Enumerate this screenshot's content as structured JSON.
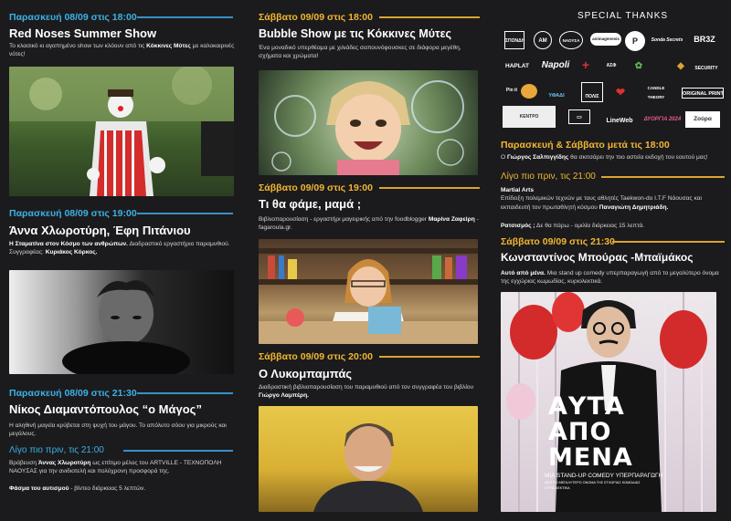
{
  "col1": {
    "e1": {
      "date": "Παρασκευή 08/09 στις 18:00",
      "title": "Red Noses Summer Show",
      "desc_a": "Το κλασικό κι αγαπημένο show των κλόουν από τις ",
      "desc_b": "Κόκκινες Μύτες",
      "desc_c": " με καλοκαιρινές νότες!"
    },
    "e2": {
      "date": "Παρασκευή 08/09 στις 19:00",
      "title": "Άννα Χλωροτύρη, Έφη Πιτάνιου",
      "desc_a": "Η Σταματίνα στον Κόσμο των ανθρώπων.",
      "desc_b": " Διαδραστικό εργαστήριο παραμυθιού.",
      "desc_c": "Συγγραφέας: ",
      "desc_d": "Κυριάκος Κόρκος."
    },
    "e3": {
      "date": "Παρασκευή 08/09 στις 21:30",
      "title": "Νίκος Διαμαντόπουλος “ο Μάγος”",
      "desc": "Η αληθινή μαγεία κρύβεται στη ψυχή του μάγου. Το απόλυτο σόου για μικρούς και μεγάλους."
    },
    "e4": {
      "date": "Λίγο πιο πριν, τις 21:00",
      "desc_a": "Βράβευση ",
      "desc_b": "Άννας Χλωροτύρη",
      "desc_c": " ως επίτιμο μέλος του ARTVILLE - ΤΕΧΝΟΠΟΛΗ ΝΑΟΥΣΑΣ για την ανιδιοτελή και πολύχρονη  προσφορά της.",
      "desc_d": "Φάσμα του αυτισμού",
      "desc_e": " - βίντεο διάρκειας 5 λεπτών."
    }
  },
  "col2": {
    "e1": {
      "date": "Σάββατο 09/09 στις 18:00",
      "title": "Bubble Show με τις Κόκκινες Μύτες",
      "desc": "Ένα μοναδικό υπερθέαμα με χιλιάδες σαπουνόφουσκες σε διάφορα μεγέθη, σχήματα και χρώματα!"
    },
    "e2": {
      "date": "Σάββατο 09/09 στις 19:00",
      "title": "Τι θα φάμε, μαμά ;",
      "desc_a": "Βιβλιοπαρουσίαση - εργαστήρι μαγειρικής από την foodblogger ",
      "desc_b": "Μαρίνα Ζαφείρη",
      "desc_c": " - fagaroula.gr."
    },
    "e3": {
      "date": "Σάββατο 09/09 στις 20:00",
      "title": "Ο Λυκομπαμπάς",
      "desc_a": "Διαδραστική βιβλιοπαρουσίαση του παραμυθιού από τον συγγραφέα του βιβλίου ",
      "desc_b": "Γιώργο Λαμπέρη."
    }
  },
  "col3": {
    "thanks": "SPECIAL THANKS",
    "logos": [
      "ΣΠΟΝΔΗ",
      "ΑΜ",
      "ΝΑΟΥΣΑ",
      "animagenesis",
      "Ρ",
      "Sonda Secrets",
      "BR3Z",
      "HAPLAT",
      "Napoli",
      "+",
      "ΑΣΦ",
      "◆",
      "SECURITY",
      "Pin it",
      "ΥΦΑΔΙ",
      "ΠΟΛΙΣ",
      "❤",
      "CANDLE THEORY",
      "ORIGINAL PRINT",
      "ΚΕΝΤΡΟ",
      "▭",
      "LineWeb",
      "ΔΥΟΡΓΙΑ 2024",
      "Ζούρα"
    ],
    "e1": {
      "date": "Παρασκευή & Σάββατο μετά τις 18:00",
      "desc_a": "Ο ",
      "desc_b": "Γιώργος Σαλπιγγίδης",
      "desc_c": " θα σκιτσάρει την πιο αστεία εκδοχή του εαυτού μας!"
    },
    "e2": {
      "date": "Λίγο πιο πριν, τις 21:00",
      "desc_a": "Martial Arts",
      "desc_b": "Επίδειξη πολεμικών τεχνών με τους αθλητές Taekwon-do I.T.F Νάουσας και εκπαιδευτή τον πρωταθλητή κόσμου ",
      "desc_c": "Παναγιώτη Δημητριάδη.",
      "desc_d": "Ρατσισμός ;",
      "desc_e": " Δε θα πάρω - ομιλία διάρκειας 15 λεπτά."
    },
    "e3": {
      "date": "Σάββατο 09/09 στις 21:30",
      "title": "Κωνσταντίνος Μπούρας -Μπαϊμάκος",
      "desc_a": "Αυτό από μένα.",
      "desc_b": " Μια stand up comedy υπερπαραγωγή από το μεγαλύτερο όνομα της εγχώριας κωμωδίας, κυριολεκτικά."
    },
    "poster": {
      "l1": "ΑΥΤΑ",
      "l2": "ΑΠΟ",
      "l3": "ΜΕΝΑ",
      "sub1": "ΜΙΑ STAND-UP COMEDY ΥΠΕΡΠΑΡΑΓΩΓΗ",
      "sub2": "ΑΠΟ ΤΟ ΜΕΓΑΛΥΤΕΡΟ ΟΝΟΜΑ ΤΗΣ ΕΓΧΩΡΙΑΣ ΚΩΜΩΔΙΑΣ",
      "sub3": "ΚΥΡΙΟΛΕΚΤΙΚΑ"
    }
  }
}
